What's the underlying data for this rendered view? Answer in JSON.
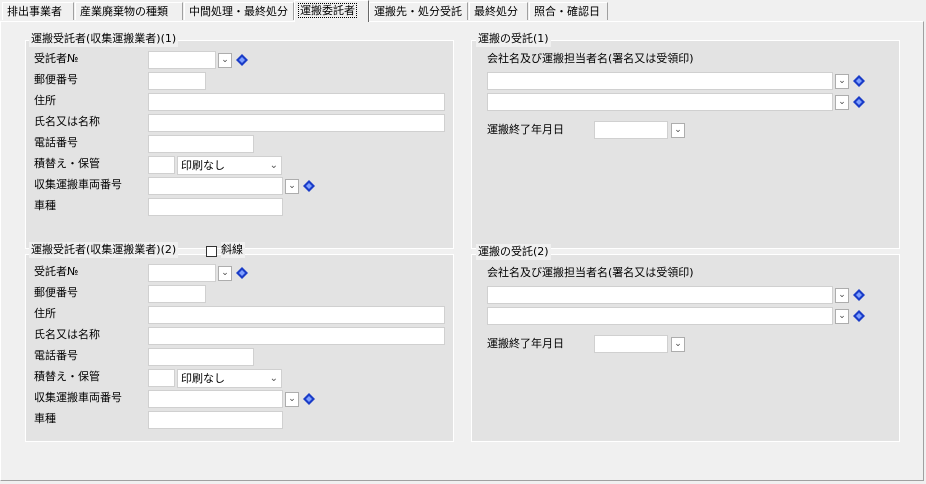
{
  "tabs": [
    {
      "label": "排出事業者",
      "active": false
    },
    {
      "label": "産業廃棄物の種類",
      "active": false
    },
    {
      "label": "中間処理・最終処分",
      "active": false
    },
    {
      "label": "運搬委託者",
      "active": true
    },
    {
      "label": "運搬先・処分受託",
      "active": false
    },
    {
      "label": "最終処分",
      "active": false
    },
    {
      "label": "照合・確認日",
      "active": false
    }
  ],
  "contractor1": {
    "title": "運搬受託者(収集運搬業者)(1)",
    "labels": {
      "trustee_no": "受託者№",
      "postal": "郵便番号",
      "address": "住所",
      "name": "氏名又は名称",
      "phone": "電話番号",
      "transship": "積替え・保管",
      "vehicle_no": "収集運搬車両番号",
      "vehicle_type": "車種"
    },
    "values": {
      "trustee_no": "",
      "postal": "",
      "address": "",
      "name": "",
      "phone": "",
      "transship": "",
      "print_option": "印刷なし",
      "vehicle_no": "",
      "vehicle_type": ""
    }
  },
  "contractor2": {
    "title": "運搬受託者(収集運搬業者)(2)",
    "strike_label": "斜線",
    "strike_checked": false,
    "labels": {
      "trustee_no": "受託者№",
      "postal": "郵便番号",
      "address": "住所",
      "name": "氏名又は名称",
      "phone": "電話番号",
      "transship": "積替え・保管",
      "vehicle_no": "収集運搬車両番号",
      "vehicle_type": "車種"
    },
    "values": {
      "trustee_no": "",
      "postal": "",
      "address": "",
      "name": "",
      "phone": "",
      "transship": "",
      "print_option": "印刷なし",
      "vehicle_no": "",
      "vehicle_type": ""
    }
  },
  "receipt1": {
    "title": "運搬の受託(1)",
    "company_label": "会社名及び運搬担当者名(署名又は受領印)",
    "company_line1": "",
    "company_line2": "",
    "end_date_label": "運搬終了年月日",
    "end_date": ""
  },
  "receipt2": {
    "title": "運搬の受託(2)",
    "company_label": "会社名及び運搬担当者名(署名又は受領印)",
    "company_line1": "",
    "company_line2": "",
    "end_date_label": "運搬終了年月日",
    "end_date": ""
  },
  "colors": {
    "lookup_icon": "#1a3cc8",
    "panel_bg": "#e3e3e3",
    "window_bg": "#f0f0f0"
  },
  "icons": {
    "dropdown": "chevron-down-icon",
    "lookup": "lookup-diamond-icon"
  }
}
